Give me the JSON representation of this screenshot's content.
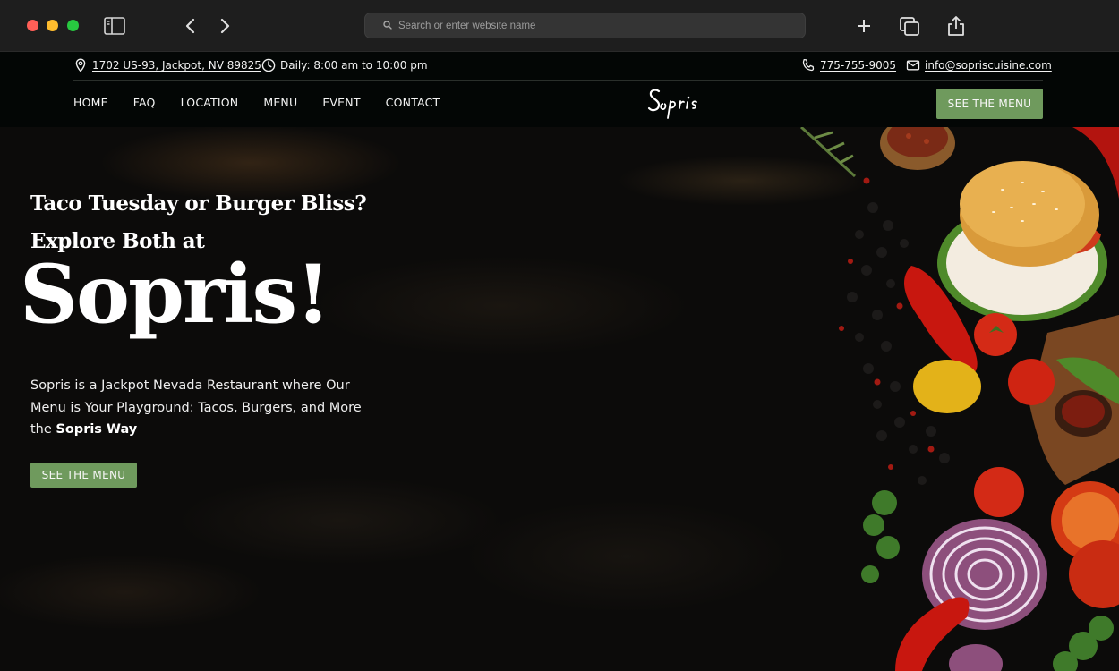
{
  "browser": {
    "url_placeholder": "Search or enter website name",
    "icons": [
      "sidebar-icon",
      "chevron-left-icon",
      "chevron-right-icon",
      "search-icon",
      "plus-icon",
      "tabs-icon",
      "share-icon"
    ]
  },
  "topbar": {
    "address": "1702 US-93, Jackpot, NV 89825",
    "hours": "Daily: 8:00 am to 10:00 pm",
    "phone": "775-755-9005",
    "email": "info@sopriscuisine.com"
  },
  "nav": {
    "items": [
      "HOME",
      "FAQ",
      "LOCATION",
      "MENU",
      "EVENT",
      "CONTACT"
    ],
    "logo_text": "Sopris",
    "cta": "SEE THE MENU"
  },
  "hero": {
    "kicker_line1": "Taco Tuesday or Burger Bliss?",
    "kicker_line2": "Explore Both at",
    "title": "Sopris!",
    "body_text": "Sopris is a Jackpot Nevada Restaurant where Our Menu is Your Playground: Tacos, Burgers, and More the",
    "body_bold": "Sopris Way",
    "cta": "SEE THE MENU"
  },
  "colors": {
    "accent_green": "#6f9a5d",
    "header_bg": "#030605",
    "hero_bg": "#0c0b0a",
    "chrome_bg": "#1e1e1e"
  }
}
